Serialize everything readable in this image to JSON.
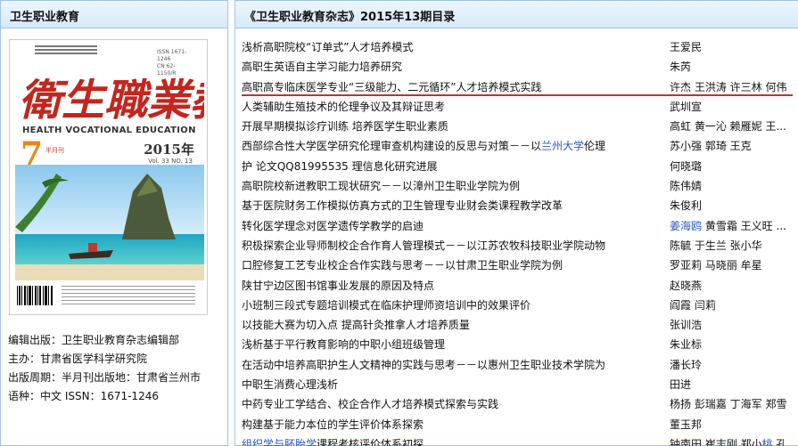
{
  "left_panel": {
    "title": "卫生职业教育",
    "cover": {
      "masthead": "衛生職業教育",
      "english_title": "HEALTH VOCATIONAL EDUCATION",
      "year": "2015年",
      "vol_no": "Vol. 33  NO. 13",
      "issue_number": "7",
      "semi_monthly": "半月刊"
    },
    "info": [
      "编辑出版：卫生职业教育杂志编辑部",
      "主办：甘肃省医学科学研究院",
      "出版周期：半月刊出版地：甘肃省兰州市",
      "语种：中文    ISSN：1671-1246"
    ]
  },
  "toc": {
    "title": "《卫生职业教育杂志》2015年13期目录",
    "rows": [
      {
        "title": "浅析高职院校“订单式”人才培养模式",
        "authors": "王爱民"
      },
      {
        "title": "高职生英语自主学习能力培养研究",
        "authors": "朱芮"
      },
      {
        "title": "高职高专临床医学专业“三级能力、二元循环”人才培养模式实践",
        "authors": "许杰 王洪涛 许三林 何伟",
        "active": true
      },
      {
        "title": "人类辅助生殖技术的伦理争议及其辩证思考",
        "authors": "武圳宣"
      },
      {
        "title": "开展早期模拟诊疗训练 培养医学生职业素质",
        "authors": "高虹 黄一沁 赖雁妮 王..."
      },
      {
        "title": "西部综合性大学医学研究伦理审查机构建设的反思与对策－－以",
        "title_hl": "兰州大学",
        "title_tail": "伦理",
        "authors": "苏小强 郭琦 王克"
      },
      {
        "title": "护 论文QQ81995535 理信息化研究进展",
        "authors": "何晓璐"
      },
      {
        "title": "高职院校新进教职工现状研究－－以漳州卫生职业学院为例",
        "authors": "陈伟婧"
      },
      {
        "title": "基于医院财务工作模拟仿真方式的卫生管理专业财会类课程教学改革",
        "authors": "朱俊利"
      },
      {
        "title": "转化医学理念对医学遗传学教学的启迪",
        "authors": "",
        "authors_hl": "姜海鸥",
        "authors_tail": " 黄雪霜 王义旺 ..."
      },
      {
        "title": "积极探索企业导师制校企合作育人管理模式－－以江苏农牧科技职业学院动物",
        "authors": "陈毓 于生兰 张小华"
      },
      {
        "title": "口腔修复工艺专业校企合作实践与思考－－以甘肃卫生职业学院为例",
        "authors": "罗亚莉 马晓丽 牟星"
      },
      {
        "title": "陕甘宁边区图书馆事业发展的原因及特点",
        "authors": "赵晓燕"
      },
      {
        "title": "小班制三段式专题培训模式在临床护理师资培训中的效果评价",
        "authors": "阎霞 闫莉"
      },
      {
        "title": "以技能大赛为切入点 提高针灸推拿人才培养质量",
        "authors": "张训浩"
      },
      {
        "title": "浅析基于平行教育影响的中职小组班级管理",
        "authors": "朱业标"
      },
      {
        "title": "在活动中培养高职护生人文精神的实践与思考－－以惠州卫生职业技术学院为",
        "authors": "潘长玲"
      },
      {
        "title": "中职生消费心理浅析",
        "authors": "田进"
      },
      {
        "title": "中药专业工学结合、校企合作人才培养模式探索与实践",
        "authors": "杨扬 彭瑞嘉 丁海军 郑雪"
      },
      {
        "title": "构建基于能力本位的学生评价体系探索",
        "authors": "董玉邦"
      },
      {
        "title": "",
        "title_hl": "组织学与胚胎学",
        "title_tail": "课程考核评价体系初探",
        "authors": "钟南田 崔志刚 郑小",
        "authors_hl": "桃",
        "authors_tail": " 孔..."
      }
    ]
  },
  "colors": {
    "border": "#9ec5e6",
    "header_bg": "#d7e9f8",
    "link": "#2a56c6",
    "underline": "#b23a2a"
  }
}
